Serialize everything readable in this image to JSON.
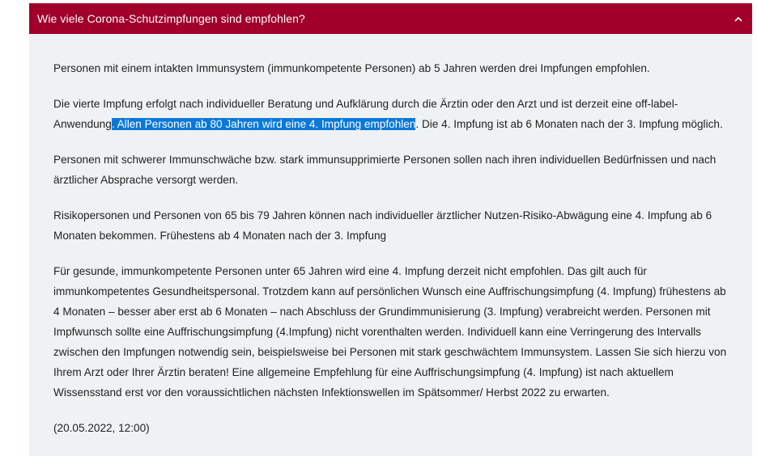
{
  "accordion": {
    "title": "Wie viele Corona-Schutzimpfungen sind empfohlen?",
    "expanded": true,
    "header_color": "#a0002a",
    "body_color": "#eef2f3",
    "toggle_icon": "chevron-up-icon"
  },
  "content": {
    "p1": "Personen mit einem intakten Immunsystem (immunkompetente Personen) ab 5 Jahren  werden drei Impfungen empfohlen.",
    "p2_before": "Die vierte Impfung erfolgt nach individueller Beratung und Aufklärung durch die Ärztin oder den Arzt und ist derzeit eine off-label-Anwendung",
    "p2_selected": ". Allen Personen ab 80 Jahren wird eine 4. Impfung empfohlen",
    "p2_after": ". Die 4. Impfung ist ab 6 Monaten nach der 3. Impfung möglich.",
    "p3": "Personen mit schwerer Immunschwäche bzw. stark immunsupprimierte Personen sollen nach ihren individuellen Bedürfnissen und nach ärztlicher Absprache versorgt werden.",
    "p4": "Risikopersonen und Personen von 65 bis 79 Jahren können nach individueller ärztlicher Nutzen-Risiko-Abwägung eine 4. Impfung ab 6 Monaten bekommen. Frühestens ab 4 Monaten nach der 3. Impfung",
    "p5": "Für gesunde, immunkompetente Personen unter 65 Jahren wird eine 4. Impfung derzeit nicht empfohlen. Das gilt auch für immunkompetentes Gesundheitspersonal. Trotzdem kann auf persönlichen Wunsch eine Auffrischungsimpfung (4. Impfung) frühestens ab 4 Monaten – besser aber erst ab 6 Monaten – nach Abschluss der Grundimmunisierung (3. Impfung) verabreicht werden. Personen mit Impfwunsch sollte eine Auffrischungsimpfung (4.Impfung) nicht vorenthalten werden. Individuell kann eine Verringerung des Intervalls zwischen den Impfungen notwendig sein, beispielsweise bei Personen mit stark geschwächtem Immunsystem. Lassen Sie sich hierzu von Ihrem Arzt oder Ihrer Ärztin beraten! Eine allgemeine Empfehlung für eine Auffrischungsimpfung (4. Impfung) ist nach aktuellem Wissensstand erst vor den voraussichtlichen nächsten Infektionswellen im Spätsommer/ Herbst 2022 zu erwarten.",
    "timestamp": "(20.05.2022, 12:00)"
  },
  "selection_color": "#0a78d7"
}
